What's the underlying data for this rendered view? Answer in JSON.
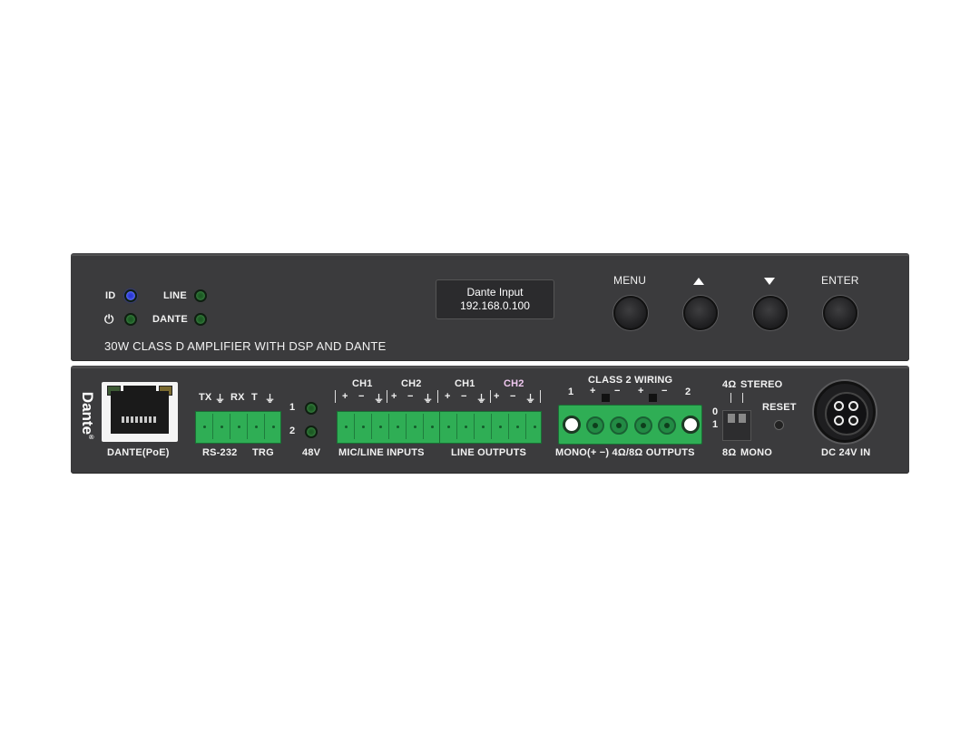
{
  "front": {
    "led_id": "ID",
    "led_line": "LINE",
    "led_power": "⏻",
    "led_dante": "DANTE",
    "model": "30W CLASS D AMPLIFIER WITH DSP AND DANTE",
    "display_line1": "Dante Input",
    "display_line2": "192.168.0.100",
    "btn_menu": "MENU",
    "btn_up": "▲",
    "btn_down": "▼",
    "btn_enter": "ENTER",
    "colors": {
      "panel": "#3b3b3d",
      "id_led": "#2a38d8",
      "status_led": "#1d5a24"
    }
  },
  "rear": {
    "brand": "Dante",
    "brand_mark": "®",
    "dante_port": "DANTE(PoE)",
    "rs232_tx": "TX",
    "rs232_rx": "RX",
    "trg_t": "T",
    "gnd": "⏚",
    "rs232": "RS-232",
    "trg": "TRG",
    "phantom_1": "1",
    "phantom_2": "2",
    "phantom": "48V",
    "ch1": "CH1",
    "ch2": "CH2",
    "plus": "+",
    "minus": "−",
    "mic_line_inputs": "MIC/LINE INPUTS",
    "line_outputs": "LINE OUTPUTS",
    "class2": "CLASS 2 WIRING",
    "spk_1": "1",
    "spk_2": "2",
    "spk_outputs": "MONO(+   −) 4Ω/8Ω OUTPUTS",
    "dip_4ohm": "4Ω",
    "dip_stereo": "STEREO",
    "dip_8ohm": "8Ω",
    "dip_mono": "MONO",
    "dip_0": "0",
    "dip_1": "1",
    "reset": "RESET",
    "dc_in": "DC 24V IN",
    "colors": {
      "terminal": "#2fae55",
      "ch2_accent": "#f0c8f0"
    }
  }
}
